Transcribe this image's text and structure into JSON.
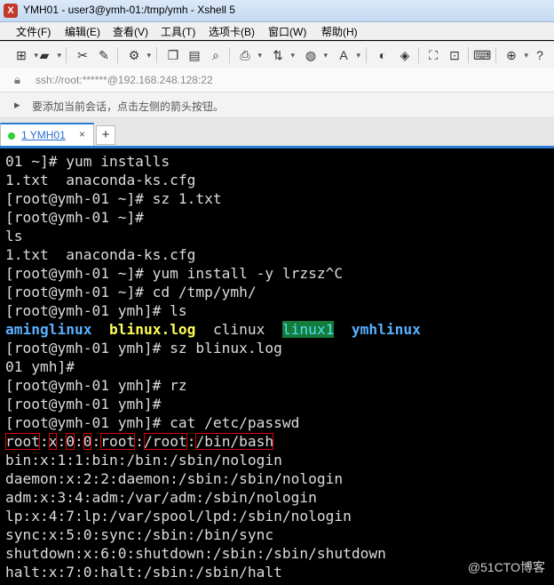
{
  "window": {
    "title": "YMH01 - user3@ymh-01:/tmp/ymh - Xshell 5"
  },
  "menu": [
    {
      "label": "文件(F)"
    },
    {
      "label": "编辑(E)"
    },
    {
      "label": "查看(V)"
    },
    {
      "label": "工具(T)"
    },
    {
      "label": "选项卡(B)"
    },
    {
      "label": "窗口(W)"
    },
    {
      "label": "帮助(H)"
    }
  ],
  "address": {
    "text": "ssh://root:******@192.168.248.128:22"
  },
  "hint": {
    "text": "要添加当前会话，点击左侧的箭头按钮。"
  },
  "tabs": [
    {
      "label": "1 YMH01",
      "close": "×",
      "status_color": "#2ecc40"
    }
  ],
  "add_tab": "+",
  "terminal": {
    "lines": [
      "01 ~]# yum installs",
      "1.txt  anaconda-ks.cfg",
      "[root@ymh-01 ~]# sz 1.txt",
      "[root@ymh-01 ~]#",
      "ls",
      "1.txt  anaconda-ks.cfg",
      "[root@ymh-01 ~]# yum install -y lrzsz^C",
      "[root@ymh-01 ~]# cd /tmp/ymh/",
      "[root@ymh-01 ymh]# ls"
    ],
    "listing": [
      "aminglinux",
      "blinux.log",
      "clinux",
      "linux1",
      "ymhlinux"
    ],
    "lines2": [
      "[root@ymh-01 ymh]# sz blinux.log",
      "01 ymh]#",
      "[root@ymh-01 ymh]# rz",
      "[root@ymh-01 ymh]#",
      "[root@ymh-01 ymh]# cat /etc/passwd"
    ],
    "passwd_root": [
      "root",
      ":",
      "x",
      ":",
      "0",
      ":",
      "0",
      ":",
      "root",
      ":",
      "/root",
      ":",
      "/bin/bash"
    ],
    "lines3": [
      "bin:x:1:1:bin:/bin:/sbin/nologin",
      "daemon:x:2:2:daemon:/sbin:/sbin/nologin",
      "adm:x:3:4:adm:/var/adm:/sbin/nologin",
      "lp:x:4:7:lp:/var/spool/lpd:/sbin/nologin",
      "sync:x:5:0:sync:/sbin:/bin/sync",
      "shutdown:x:6:0:shutdown:/sbin:/sbin/shutdown",
      "halt:x:7:0:halt:/sbin:/sbin/halt"
    ]
  },
  "watermark": "@51CTO博客",
  "colors": {
    "accent": "#2a7bd4",
    "terminal_bg": "#000000",
    "highlight_box": "#e00000"
  }
}
